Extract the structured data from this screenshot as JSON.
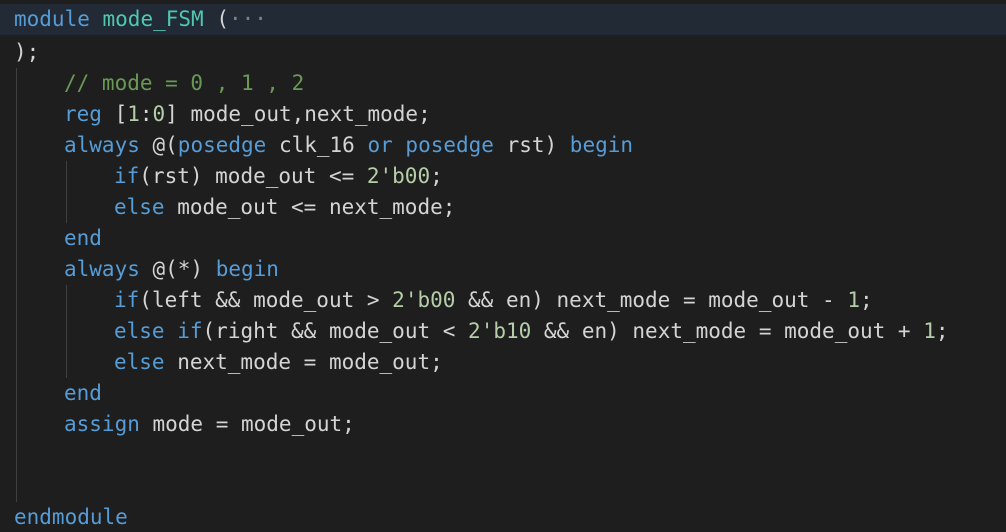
{
  "editor": {
    "fold_marker": "›",
    "lines": [
      {
        "indent": 0,
        "tokens": [
          {
            "t": "module",
            "c": "kw"
          },
          {
            "t": " ",
            "c": "id"
          },
          {
            "t": "mode_FSM",
            "c": "ty"
          },
          {
            "t": " (",
            "c": "op"
          },
          {
            "t": "···",
            "c": "fold"
          }
        ]
      },
      {
        "indent": 0,
        "tokens": [
          {
            "t": ");",
            "c": "op"
          }
        ]
      },
      {
        "indent": 1,
        "tokens": [
          {
            "t": "// mode = 0 , 1 , 2",
            "c": "cm"
          }
        ]
      },
      {
        "indent": 1,
        "tokens": [
          {
            "t": "reg",
            "c": "kw"
          },
          {
            "t": " [",
            "c": "op"
          },
          {
            "t": "1",
            "c": "num"
          },
          {
            "t": ":",
            "c": "op"
          },
          {
            "t": "0",
            "c": "num"
          },
          {
            "t": "] mode_out,next_mode;",
            "c": "id"
          }
        ]
      },
      {
        "indent": 1,
        "tokens": [
          {
            "t": "always",
            "c": "kw"
          },
          {
            "t": " @(",
            "c": "op"
          },
          {
            "t": "posedge",
            "c": "kw"
          },
          {
            "t": " clk_16 ",
            "c": "id"
          },
          {
            "t": "or",
            "c": "kw"
          },
          {
            "t": " ",
            "c": "id"
          },
          {
            "t": "posedge",
            "c": "kw"
          },
          {
            "t": " rst) ",
            "c": "id"
          },
          {
            "t": "begin",
            "c": "kw"
          }
        ]
      },
      {
        "indent": 2,
        "tokens": [
          {
            "t": "if",
            "c": "kw"
          },
          {
            "t": "(rst) mode_out <= ",
            "c": "id"
          },
          {
            "t": "2'b00",
            "c": "num"
          },
          {
            "t": ";",
            "c": "op"
          }
        ]
      },
      {
        "indent": 2,
        "tokens": [
          {
            "t": "else",
            "c": "kw"
          },
          {
            "t": " mode_out <= next_mode;",
            "c": "id"
          }
        ]
      },
      {
        "indent": 1,
        "tokens": [
          {
            "t": "end",
            "c": "kw"
          }
        ]
      },
      {
        "indent": 1,
        "tokens": [
          {
            "t": "always",
            "c": "kw"
          },
          {
            "t": " @(*) ",
            "c": "op"
          },
          {
            "t": "begin",
            "c": "kw"
          }
        ]
      },
      {
        "indent": 2,
        "tokens": [
          {
            "t": "if",
            "c": "kw"
          },
          {
            "t": "(left && mode_out > ",
            "c": "id"
          },
          {
            "t": "2'b00",
            "c": "num"
          },
          {
            "t": " && en) next_mode = mode_out - ",
            "c": "id"
          },
          {
            "t": "1",
            "c": "num"
          },
          {
            "t": ";",
            "c": "op"
          }
        ]
      },
      {
        "indent": 2,
        "tokens": [
          {
            "t": "else",
            "c": "kw"
          },
          {
            "t": " ",
            "c": "id"
          },
          {
            "t": "if",
            "c": "kw"
          },
          {
            "t": "(right && mode_out < ",
            "c": "id"
          },
          {
            "t": "2'b10",
            "c": "num"
          },
          {
            "t": " && en) next_mode = mode_out + ",
            "c": "id"
          },
          {
            "t": "1",
            "c": "num"
          },
          {
            "t": ";",
            "c": "op"
          }
        ]
      },
      {
        "indent": 2,
        "tokens": [
          {
            "t": "else",
            "c": "kw"
          },
          {
            "t": " next_mode = mode_out;",
            "c": "id"
          }
        ]
      },
      {
        "indent": 1,
        "tokens": [
          {
            "t": "end",
            "c": "kw"
          }
        ]
      },
      {
        "indent": 1,
        "tokens": [
          {
            "t": "assign",
            "c": "kw"
          },
          {
            "t": " mode = mode_out;",
            "c": "id"
          }
        ]
      },
      {
        "indent": 1,
        "tokens": []
      },
      {
        "indent": 1,
        "tokens": []
      },
      {
        "indent": 0,
        "tokens": [
          {
            "t": "endmodule",
            "c": "kw"
          }
        ]
      }
    ]
  }
}
